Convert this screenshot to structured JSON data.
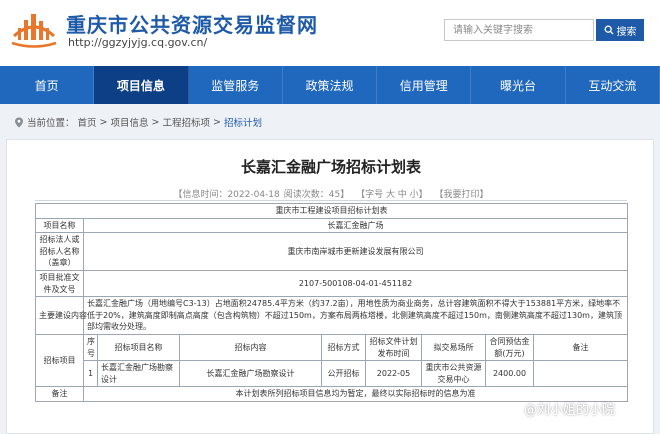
{
  "site": {
    "title": "重庆市公共资源交易监督网",
    "url": "http://ggzyjyjg.cq.gov.cn/"
  },
  "search": {
    "placeholder": "请输入关键字搜索",
    "button_label": "搜索"
  },
  "nav": {
    "items": [
      "首页",
      "项目信息",
      "监管服务",
      "政策法规",
      "信用管理",
      "曝光台",
      "互动交流"
    ],
    "active_index": 1
  },
  "breadcrumb": {
    "prefix": "当前位置：",
    "items": [
      "首页",
      "项目信息",
      "工程招标项",
      "招标计划"
    ]
  },
  "article": {
    "title": "长嘉汇金融广场招标计划表",
    "meta": [
      "【信息时间：2022-04-18",
      "阅读次数：45】",
      "【字号 大 中 小】",
      "【我要打印】"
    ]
  },
  "table": {
    "header": "重庆市工程建设项目招标计划表",
    "project_name_label": "项目名称",
    "project_name": "长嘉汇金融广场",
    "tenderer_label": "招标法人或招标人名称（盖章）",
    "tenderer": "重庆市南岸城市更新建设发展有限公司",
    "approval_label": "项目批准文件及文号",
    "approval": "2107-500108-04-01-451182",
    "content_label": "主要建设内容",
    "content": "长嘉汇金融广场（用地编号C3-13）占地面积24785.4平方米（约37.2亩），用地性质为商业商务，总计容建筑面积不得大于153881平方米，绿地率不低于20%，建筑高度即制高点高度（包含构筑物）不超过150m，方案布局两栋塔楼，北侧建筑高度不超过150m，南侧建筑高度不超过130m，建筑顶部均需收分处理。",
    "items_label": "招标项目",
    "cols": [
      "序号",
      "招标项目名称",
      "招标内容",
      "招标方式",
      "招标文件计划发布时间",
      "拟交易场所",
      "合同预估金额(万元)",
      "备注"
    ],
    "rows": [
      [
        "1",
        "长嘉汇金融广场勘察设计",
        "长嘉汇金融广场勘察设计",
        "公开招标",
        "2022-05",
        "重庆市公共资源交易中心",
        "2400.00",
        ""
      ]
    ],
    "remark_label": "备注",
    "remark": "本计划表所列招标项目信息均为暂定，最终以实际招标时的信息为准"
  },
  "watermark": "@刘小姐的小院",
  "colors": {
    "brand_blue": "#1e5aa8",
    "nav_blue": "#2067be",
    "nav_active": "#0d3f86",
    "logo_orange": "#e8762b"
  }
}
